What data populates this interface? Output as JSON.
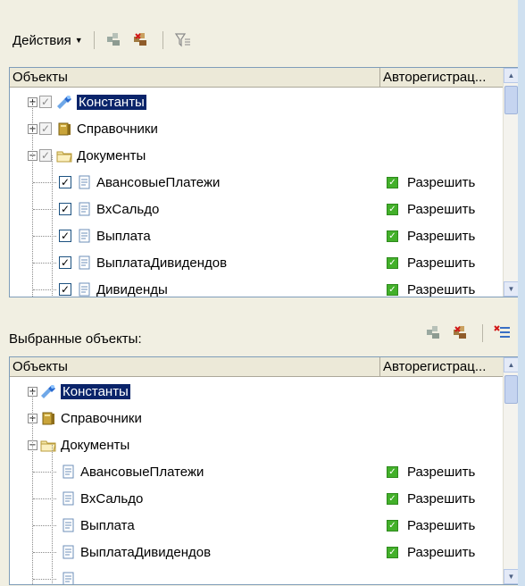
{
  "toolbar": {
    "actions_label": "Действия",
    "icons": [
      "register-icon",
      "unregister-icon",
      "filter-icon"
    ]
  },
  "top_grid": {
    "columns": [
      "Объекты",
      "Авторегистрац..."
    ],
    "rows": [
      {
        "label": "Константы",
        "level": 0,
        "expander": "+",
        "check": "gray",
        "icon": "constants-icon",
        "auto": "",
        "selected": true
      },
      {
        "label": "Справочники",
        "level": 0,
        "expander": "+",
        "check": "gray",
        "icon": "catalogs-icon",
        "auto": "",
        "selected": false
      },
      {
        "label": "Документы",
        "level": 0,
        "expander": "−",
        "check": "gray",
        "icon": "folder-icon",
        "auto": "",
        "selected": false
      },
      {
        "label": "АвансовыеПлатежи",
        "level": 1,
        "expander": "",
        "check": "checked",
        "icon": "document-icon",
        "auto": "Разрешить",
        "selected": false
      },
      {
        "label": "ВхСальдо",
        "level": 1,
        "expander": "",
        "check": "checked",
        "icon": "document-icon",
        "auto": "Разрешить",
        "selected": false
      },
      {
        "label": "Выплата",
        "level": 1,
        "expander": "",
        "check": "checked",
        "icon": "document-icon",
        "auto": "Разрешить",
        "selected": false
      },
      {
        "label": "ВыплатаДивидендов",
        "level": 1,
        "expander": "",
        "check": "checked",
        "icon": "document-icon",
        "auto": "Разрешить",
        "selected": false
      },
      {
        "label": "Дивиденды",
        "level": 1,
        "expander": "",
        "check": "checked",
        "icon": "document-icon",
        "auto": "Разрешить",
        "selected": false
      }
    ]
  },
  "selected_label": "Выбранные объекты:",
  "toolbar2": {
    "icons": [
      "register-icon",
      "unregister-icon",
      "clear-icon"
    ]
  },
  "bottom_grid": {
    "columns": [
      "Объекты",
      "Авторегистрац..."
    ],
    "rows": [
      {
        "label": "Константы",
        "level": 0,
        "expander": "+",
        "icon": "constants-icon",
        "auto": "",
        "selected": true
      },
      {
        "label": "Справочники",
        "level": 0,
        "expander": "+",
        "icon": "catalogs-icon",
        "auto": "",
        "selected": false
      },
      {
        "label": "Документы",
        "level": 0,
        "expander": "−",
        "icon": "folder-icon",
        "auto": "",
        "selected": false
      },
      {
        "label": "АвансовыеПлатежи",
        "level": 1,
        "expander": "",
        "icon": "document-icon",
        "auto": "Разрешить",
        "selected": false
      },
      {
        "label": "ВхСальдо",
        "level": 1,
        "expander": "",
        "icon": "document-icon",
        "auto": "Разрешить",
        "selected": false
      },
      {
        "label": "Выплата",
        "level": 1,
        "expander": "",
        "icon": "document-icon",
        "auto": "Разрешить",
        "selected": false
      },
      {
        "label": "ВыплатаДивидендов",
        "level": 1,
        "expander": "",
        "icon": "document-icon",
        "auto": "Разрешить",
        "selected": false
      },
      {
        "label": "",
        "level": 1,
        "expander": "",
        "icon": "document-icon",
        "auto": "",
        "selected": false
      }
    ]
  },
  "colors": {
    "panel": "#f1efe2",
    "selection": "#0a246a",
    "allow_green": "#43b02a",
    "border": "#7f9db9"
  }
}
